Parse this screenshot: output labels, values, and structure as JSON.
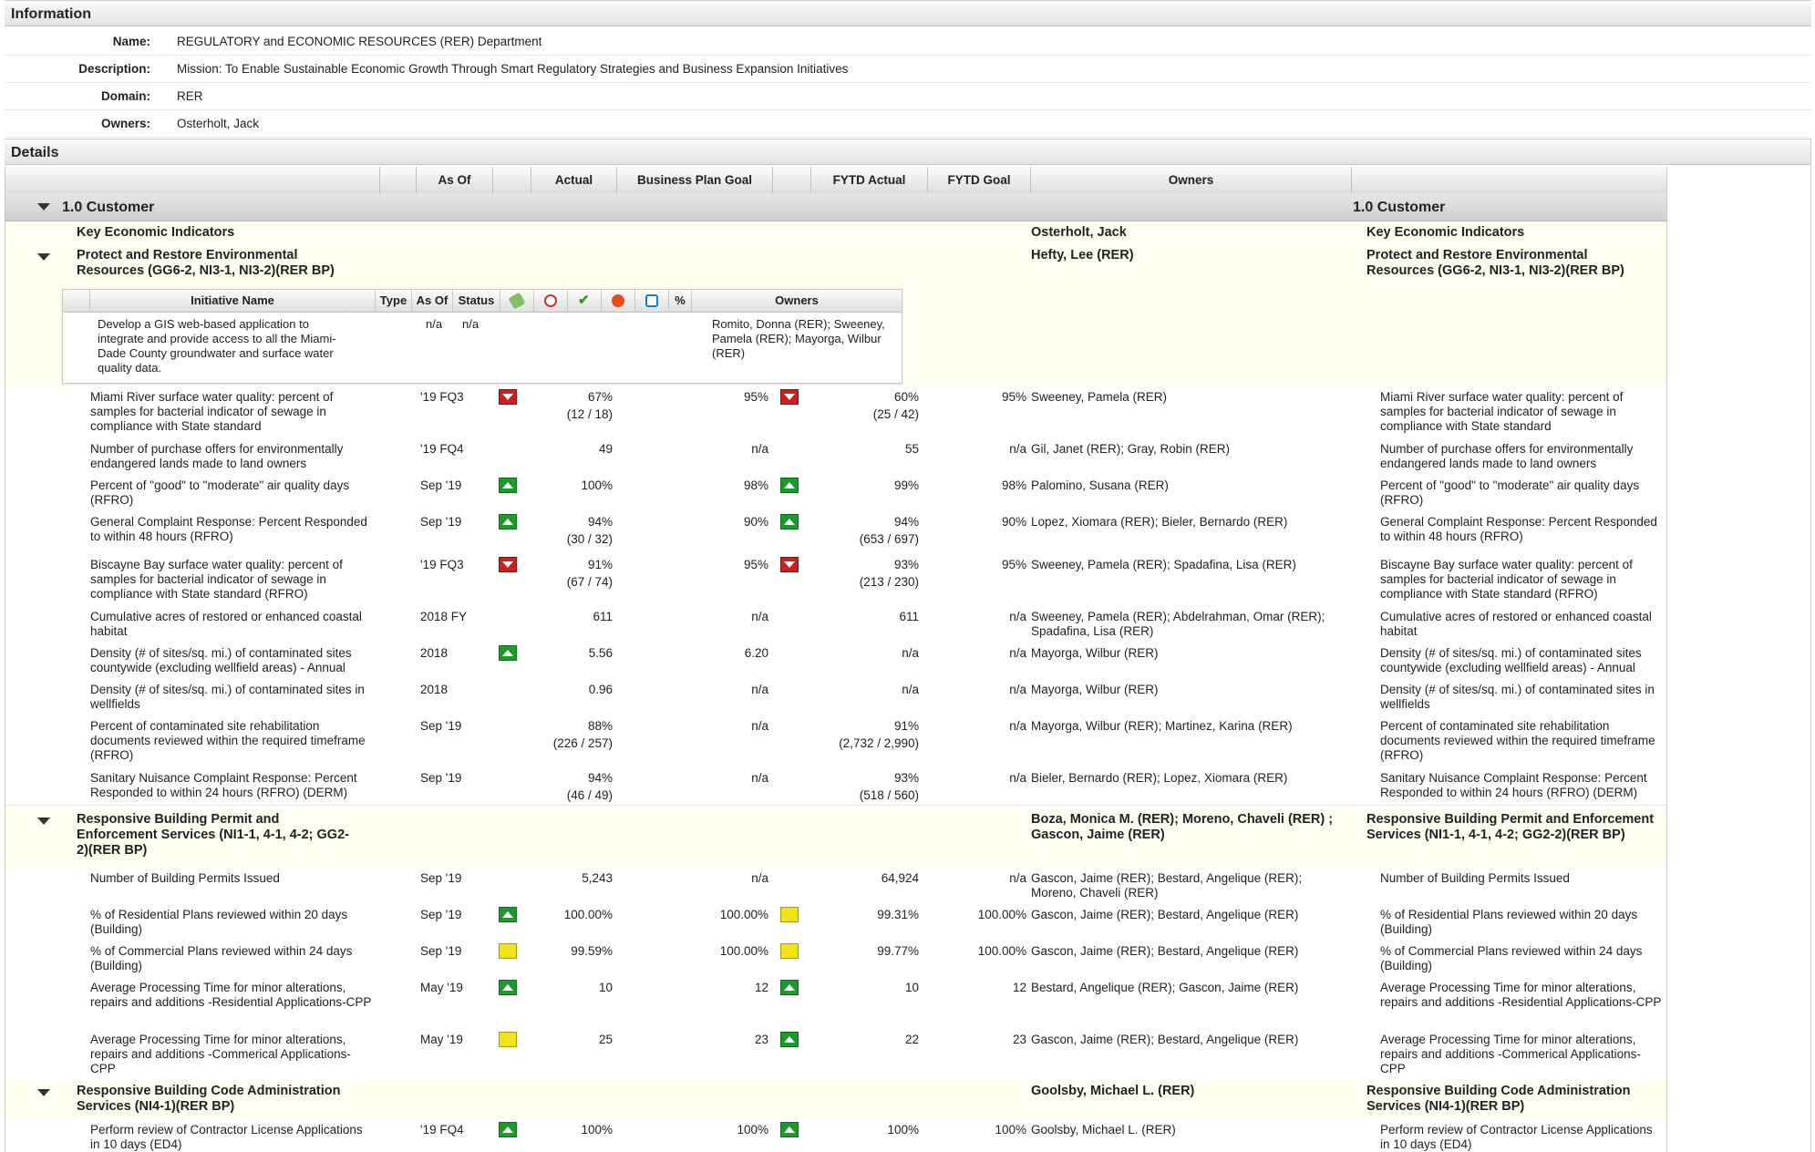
{
  "information": {
    "header": "Information",
    "rows": [
      {
        "label": "Name:",
        "value": "REGULATORY and ECONOMIC RESOURCES (RER) Department"
      },
      {
        "label": "Description:",
        "value": "Mission:  To Enable Sustainable Economic Growth Through Smart Regulatory Strategies and Business Expansion Initiatives"
      },
      {
        "label": "Domain:",
        "value": "RER"
      },
      {
        "label": "Owners:",
        "value": "Osterholt, Jack"
      }
    ]
  },
  "details": {
    "header": "Details",
    "columns": {
      "as_of": "As Of",
      "actual": "Actual",
      "bp_goal": "Business Plan Goal",
      "fytd_actual": "FYTD Actual",
      "fytd_goal": "FYTD Goal",
      "owners": "Owners"
    },
    "perspective": {
      "name": "1.0 Customer",
      "right_name": "1.0 Customer"
    },
    "kei": {
      "name": "Key Economic Indicators",
      "owner": "Osterholt, Jack"
    },
    "objective1": {
      "name": "Protect and Restore Environmental Resources (GG6-2, NI3-1, NI3-2)(RER BP)",
      "owner": "Hefty, Lee (RER)"
    },
    "initiatives": {
      "columns": {
        "name": "Initiative Name",
        "type": "Type",
        "as_of": "As Of",
        "status": "Status",
        "percent": "%",
        "owners": "Owners"
      },
      "rows": [
        {
          "name": "Develop a GIS web-based application to integrate and provide access to all the Miami-Dade County groundwater and surface water quality data.",
          "type": "",
          "as_of": "n/a",
          "status": "n/a",
          "owners": "Romito, Donna (RER); Sweeney, Pamela (RER); Mayorga, Wilbur (RER)"
        }
      ]
    },
    "measures1": [
      {
        "name": "Miami River surface water quality: percent of samples for bacterial indicator of sewage in compliance with State standard",
        "as_of": "'19 FQ3",
        "status": "red",
        "actual": "67%",
        "actual_frac": "(12 / 18)",
        "bp_goal": "95%",
        "fytd_status": "red",
        "fytd_actual": "60%",
        "fytd_frac": "(25 / 42)",
        "fytd_goal": "95%",
        "owners": "Sweeney, Pamela (RER)"
      },
      {
        "name": "Number of purchase offers for environmentally endangered lands made to land owners",
        "as_of": "'19 FQ4",
        "status": "",
        "actual": "49",
        "actual_frac": "",
        "bp_goal": "n/a",
        "fytd_status": "",
        "fytd_actual": "55",
        "fytd_frac": "",
        "fytd_goal": "n/a",
        "owners": "Gil, Janet (RER); Gray, Robin (RER)"
      },
      {
        "name": "Percent of \"good\" to \"moderate\" air quality days (RFRO)",
        "as_of": "Sep '19",
        "status": "green",
        "actual": "100%",
        "actual_frac": "",
        "bp_goal": "98%",
        "fytd_status": "green",
        "fytd_actual": "99%",
        "fytd_frac": "",
        "fytd_goal": "98%",
        "owners": "Palomino, Susana (RER)"
      },
      {
        "name": "General Complaint Response: Percent Responded to within 48 hours (RFRO)",
        "as_of": "Sep '19",
        "status": "green",
        "actual": "94%",
        "actual_frac": "(30 / 32)",
        "bp_goal": "90%",
        "fytd_status": "green",
        "fytd_actual": "94%",
        "fytd_frac": "(653 / 697)",
        "fytd_goal": "90%",
        "owners": "Lopez, Xiomara (RER); Bieler, Bernardo (RER)"
      },
      {
        "name": "Biscayne Bay surface water quality: percent of samples for bacterial indicator of sewage in compliance with State standard (RFRO)",
        "as_of": "'19 FQ3",
        "status": "red",
        "actual": "91%",
        "actual_frac": "(67 / 74)",
        "bp_goal": "95%",
        "fytd_status": "red",
        "fytd_actual": "93%",
        "fytd_frac": "(213 / 230)",
        "fytd_goal": "95%",
        "owners": "Sweeney, Pamela (RER); Spadafina, Lisa (RER)"
      },
      {
        "name": "Cumulative acres of restored or enhanced coastal habitat",
        "as_of": "2018 FY",
        "status": "",
        "actual": "611",
        "actual_frac": "",
        "bp_goal": "n/a",
        "fytd_status": "",
        "fytd_actual": "611",
        "fytd_frac": "",
        "fytd_goal": "n/a",
        "owners": "Sweeney, Pamela (RER); Abdelrahman, Omar (RER); Spadafina, Lisa (RER)"
      },
      {
        "name": "Density (# of sites/sq. mi.) of contaminated sites countywide (excluding wellfield areas) - Annual",
        "as_of": "2018",
        "status": "green",
        "actual": "5.56",
        "actual_frac": "",
        "bp_goal": "6.20",
        "fytd_status": "",
        "fytd_actual": "n/a",
        "fytd_frac": "",
        "fytd_goal": "n/a",
        "owners": "Mayorga, Wilbur (RER)"
      },
      {
        "name": "Density (# of sites/sq. mi.) of contaminated sites in wellfields",
        "as_of": "2018",
        "status": "",
        "actual": "0.96",
        "actual_frac": "",
        "bp_goal": "n/a",
        "fytd_status": "",
        "fytd_actual": "n/a",
        "fytd_frac": "",
        "fytd_goal": "n/a",
        "owners": "Mayorga, Wilbur (RER)"
      },
      {
        "name": "Percent of contaminated site rehabilitation documents reviewed within the required timeframe (RFRO)",
        "as_of": "Sep '19",
        "status": "",
        "actual": "88%",
        "actual_frac": "(226 / 257)",
        "bp_goal": "n/a",
        "fytd_status": "",
        "fytd_actual": "91%",
        "fytd_frac": "(2,732 / 2,990)",
        "fytd_goal": "n/a",
        "owners": "Mayorga, Wilbur (RER); Martinez, Karina (RER)"
      },
      {
        "name": "Sanitary Nuisance Complaint Response: Percent Responded to within 24 hours (RFRO) (DERM)",
        "as_of": "Sep '19",
        "status": "",
        "actual": "94%",
        "actual_frac": "(46 / 49)",
        "bp_goal": "n/a",
        "fytd_status": "",
        "fytd_actual": "93%",
        "fytd_frac": "(518 / 560)",
        "fytd_goal": "n/a",
        "owners": "Bieler, Bernardo (RER); Lopez, Xiomara (RER)"
      }
    ],
    "objective2": {
      "name": "Responsive Building Permit and Enforcement Services (NI1-1, 4-1, 4-2; GG2-2)(RER BP)",
      "owner": "Boza, Monica M. (RER); Moreno, Chaveli (RER) ; Gascon, Jaime (RER)"
    },
    "measures2": [
      {
        "name": "Number of Building Permits Issued",
        "as_of": "Sep '19",
        "status": "",
        "actual": "5,243",
        "actual_frac": "",
        "bp_goal": "n/a",
        "fytd_status": "",
        "fytd_actual": "64,924",
        "fytd_frac": "",
        "fytd_goal": "n/a",
        "owners": "Gascon, Jaime (RER); Bestard, Angelique (RER); Moreno, Chaveli (RER)"
      },
      {
        "name": "% of Residential Plans reviewed within 20 days (Building)",
        "as_of": "Sep '19",
        "status": "green",
        "actual": "100.00%",
        "actual_frac": "",
        "bp_goal": "100.00%",
        "fytd_status": "yellow",
        "fytd_actual": "99.31%",
        "fytd_frac": "",
        "fytd_goal": "100.00%",
        "owners": "Gascon, Jaime (RER); Bestard, Angelique (RER)"
      },
      {
        "name": "% of Commercial Plans reviewed within 24 days (Building)",
        "as_of": "Sep '19",
        "status": "yellow",
        "actual": "99.59%",
        "actual_frac": "",
        "bp_goal": "100.00%",
        "fytd_status": "yellow",
        "fytd_actual": "99.77%",
        "fytd_frac": "",
        "fytd_goal": "100.00%",
        "owners": "Gascon, Jaime (RER); Bestard, Angelique (RER)"
      },
      {
        "name": "Average Processing Time for minor alterations, repairs and additions -Residential Applications-CPP",
        "as_of": "May '19",
        "status": "green",
        "actual": "10",
        "actual_frac": "",
        "bp_goal": "12",
        "fytd_status": "green",
        "fytd_actual": "10",
        "fytd_frac": "",
        "fytd_goal": "12",
        "owners": "Bestard, Angelique (RER); Gascon, Jaime (RER)"
      },
      {
        "name": "Average Processing Time for minor alterations, repairs and additions -Commerical Applications-CPP",
        "as_of": "May '19",
        "status": "yellow",
        "actual": "25",
        "actual_frac": "",
        "bp_goal": "23",
        "fytd_status": "green",
        "fytd_actual": "22",
        "fytd_frac": "",
        "fytd_goal": "23",
        "owners": "Gascon, Jaime (RER); Bestard, Angelique (RER)"
      }
    ],
    "objective3": {
      "name": "Responsive Building Code Administration Services (NI4-1)(RER BP)",
      "owner": "Goolsby, Michael L. (RER)"
    },
    "measures3": [
      {
        "name": "Perform review of Contractor License Applications in 10 days (ED4)",
        "as_of": "'19 FQ4",
        "status": "green",
        "actual": "100%",
        "actual_frac": "",
        "bp_goal": "100%",
        "fytd_status": "green",
        "fytd_actual": "100%",
        "fytd_frac": "",
        "fytd_goal": "100%",
        "owners": "Goolsby, Michael L. (RER)"
      }
    ]
  }
}
